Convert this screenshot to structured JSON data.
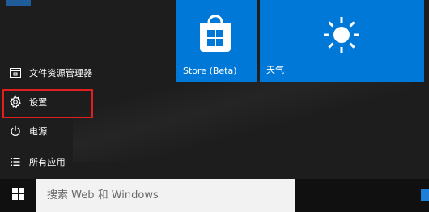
{
  "start_menu": {
    "items": [
      {
        "label": "文件资源管理器",
        "icon": "folder-icon"
      },
      {
        "label": "设置",
        "icon": "gear-icon"
      },
      {
        "label": "电源",
        "icon": "power-icon"
      },
      {
        "label": "所有应用",
        "icon": "list-icon"
      }
    ],
    "highlighted_item": "设置",
    "highlight_color": "#e02020"
  },
  "tiles": [
    {
      "label": "Store (Beta)",
      "icon": "store-bag-icon",
      "color": "#0078d7"
    },
    {
      "label": "天气",
      "icon": "sun-icon",
      "color": "#0078d7"
    }
  ],
  "taskbar": {
    "start_icon": "windows-logo-icon",
    "search_placeholder": "搜索 Web 和 Windows",
    "tray_icon": "tray-icon",
    "tray_color": "#1f7fd8"
  }
}
